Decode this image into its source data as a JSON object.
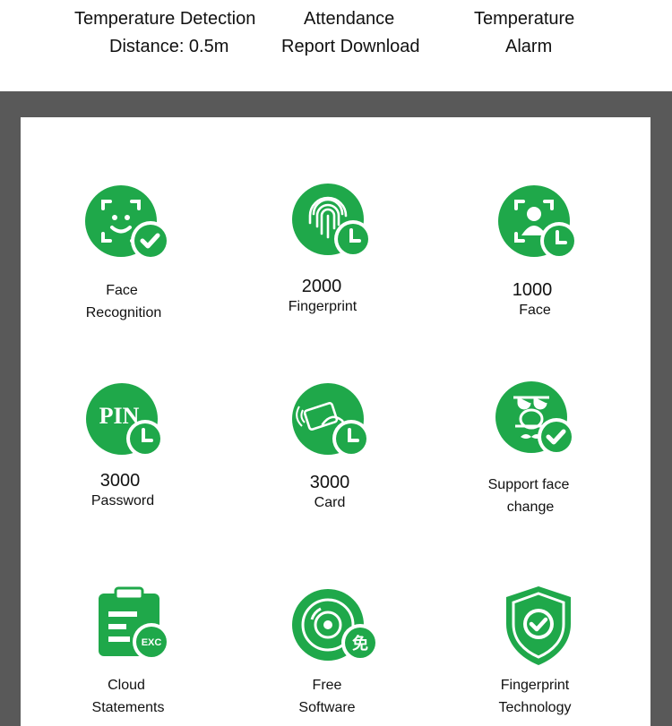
{
  "top_features": [
    {
      "line1": "Temperature Detection",
      "line2": "Distance: 0.5m"
    },
    {
      "line1": "Attendance",
      "line2": "Report Download"
    },
    {
      "line1": "Temperature",
      "line2": "Alarm"
    }
  ],
  "features": [
    {
      "icon": "face-recognition-icon",
      "line1": "Face",
      "line2": "Recognition"
    },
    {
      "icon": "fingerprint-icon",
      "line1": "2000",
      "line2": "Fingerprint"
    },
    {
      "icon": "face-capacity-icon",
      "line1": "1000",
      "line2": "Face"
    },
    {
      "icon": "pin-icon",
      "icon_text": "PIN",
      "line1": "3000",
      "line2": "Password"
    },
    {
      "icon": "card-icon",
      "line1": "3000",
      "line2": "Card"
    },
    {
      "icon": "face-change-icon",
      "line1": "Support face",
      "line2": "change"
    },
    {
      "icon": "cloud-statements-icon",
      "icon_text": "EXC",
      "line1": "Cloud",
      "line2": "Statements"
    },
    {
      "icon": "free-software-icon",
      "icon_text": "免",
      "line1": "Free",
      "line2": "Software"
    },
    {
      "icon": "fingerprint-technology-icon",
      "line1": "Fingerprint",
      "line2": "Technology"
    }
  ],
  "colors": {
    "green": "#1fa84a",
    "dark_green": "#0f8a36",
    "frame": "#595959"
  }
}
